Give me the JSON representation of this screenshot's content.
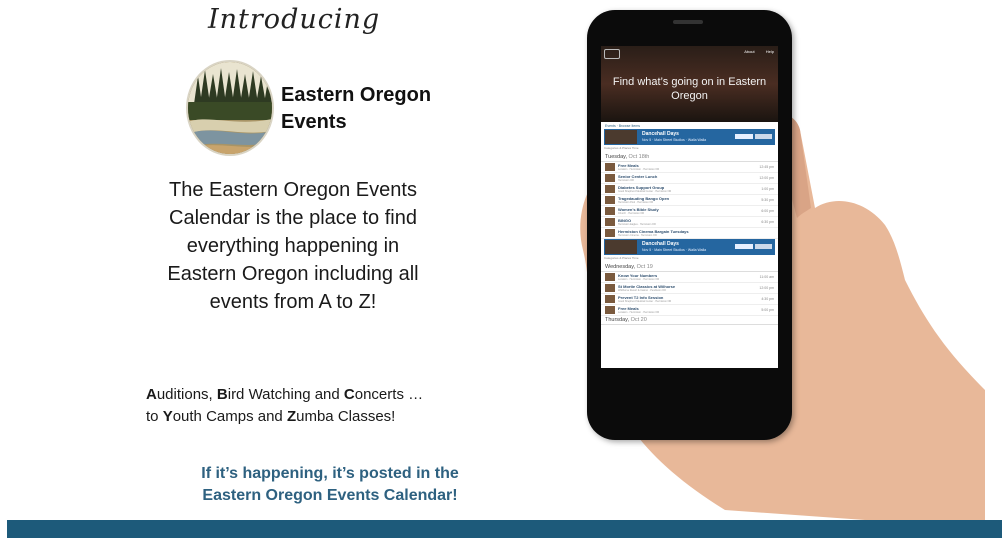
{
  "promo": {
    "intro": "Introducing",
    "brand_line1": "Eastern Oregon",
    "brand_line2": "Events",
    "blurb": "The Eastern Oregon Events Calendar is the place to find everything happening in Eastern Oregon including all events from A to Z!",
    "az_line1_parts": [
      "A",
      "uditions, ",
      "B",
      "ird Watching and ",
      "C",
      "oncerts …"
    ],
    "az_line2_parts": [
      "to ",
      "Y",
      "outh Camps and ",
      "Z",
      "umba Classes!"
    ],
    "tagline_line1": "If it’s happening, it’s posted in the",
    "tagline_line2": "Eastern Oregon Events Calendar!"
  },
  "colors": {
    "accent_blue": "#2e6180",
    "bottom_bar": "#1d5a7a",
    "banner_blue": "#2566a0"
  },
  "phone_screen": {
    "nav_about": "About",
    "nav_help": "Help",
    "hero_title": "Find what’s going on in Eastern Oregon",
    "tabs": "Events · Browse Items",
    "banner": {
      "title": "Dancehall Days",
      "subtitle": "Nov 5 · Main Street Studios · Walla Walla"
    },
    "toolbar_text": "Categories & Places   Time",
    "days": [
      {
        "heading": "Tuesday,",
        "date": "Oct 18th",
        "events": [
          {
            "title": "Free Meals",
            "meta": "Location · Hermiston · Hermiston OR",
            "time": "12:45 pm"
          },
          {
            "title": "Senior Center Lunch",
            "meta": "Hermiston OR",
            "time": "12:00 pm"
          },
          {
            "title": "Diabetes Support Group",
            "meta": "Good Shepherd Medical Center · Hermiston OR",
            "time": "1:00 pm"
          },
          {
            "title": "Tragedauding Bango Open",
            "meta": "Hermiston Pool · Hermiston OR",
            "time": "5:30 pm"
          },
          {
            "title": "Women’s Bible Study",
            "meta": "Church · Hermiston OR",
            "time": "6:00 pm"
          },
          {
            "title": "BINGO",
            "meta": "Hermiston Eagles · Hermiston OR",
            "time": "6:30 pm"
          },
          {
            "title": "Hermiston Cinema Bargain Tuesdays",
            "meta": "Hermiston Cinema · Hermiston OR",
            "time": ""
          }
        ]
      },
      {
        "heading": "Wednesday,",
        "date": "Oct 19",
        "events": [
          {
            "title": "Know Your Numbers",
            "meta": "Location · Hermiston · Hermiston OR",
            "time": "11:00 am"
          },
          {
            "title": "St Mortie Classics at Wilhorse",
            "meta": "Wildhorse Resort & Casino · Pendleton OR",
            "time": "12:00 pm"
          },
          {
            "title": "Prevent T2 Info Session",
            "meta": "Good Shepherd Medical Center · Hermiston OR",
            "time": "4:30 pm"
          },
          {
            "title": "Free Meals",
            "meta": "Location · Hermiston · Hermiston OR",
            "time": "5:00 pm"
          }
        ]
      },
      {
        "heading": "Thursday,",
        "date": "Oct 20",
        "events": []
      }
    ]
  }
}
